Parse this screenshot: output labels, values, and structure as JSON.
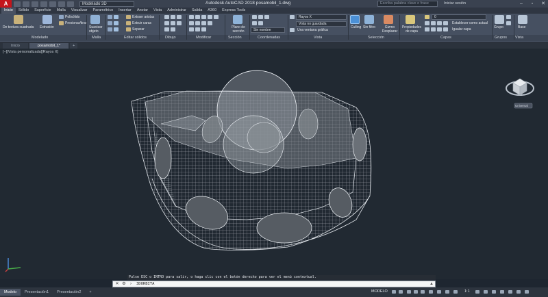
{
  "titlebar": {
    "app_letter": "A",
    "workspace": "Modelado 3D",
    "title": "Autodesk AutoCAD 2018    posamobil_1.dwg",
    "search_placeholder": "Escriba palabra clave o frase",
    "signin": "Iniciar sesión"
  },
  "ribbon_tabs": [
    "Inicio",
    "Sólido",
    "Superficie",
    "Malla",
    "Visualizar",
    "Paramétrico",
    "Insertar",
    "Anotar",
    "Vista",
    "Administrar",
    "Salida",
    "A360",
    "Express Tools"
  ],
  "ribbon": {
    "panels": [
      "Modelado",
      "Malla",
      "Editar sólidos",
      "Dibujo",
      "Modificar",
      "Sección",
      "Coordenadas",
      "Vista",
      "Selección",
      "Capas",
      "Grupos",
      "Vista"
    ],
    "modelado": {
      "box": "De textura cuadrada",
      "extrude": "Extrusión",
      "polysolid": "Polisólido",
      "presspull": "Presionar/tirar"
    },
    "malla": {
      "smooth": "Suavizar objeto"
    },
    "editar": {
      "extrude_edges": "Extraer aristas",
      "extrude_faces": "Extruir caras",
      "separate": "Separar"
    },
    "seccion": {
      "plane": "Plano de sección"
    },
    "coordenadas": {
      "ucs": "Universal",
      "named": "Sin nombre"
    },
    "vista": {
      "visual_style": "Rayos X",
      "saved_view": "Vista no guardada",
      "viewport": "Una ventana gráfica"
    },
    "seleccion": {
      "culling": "Culling",
      "nofilter": "Sin filtro",
      "gizmo": "Gizmo Desplazar"
    },
    "capas": {
      "properties": "Propiedades de capa",
      "layer_value": "0",
      "set_current": "Establecer como actual",
      "match": "Igualar capa"
    },
    "grupos": {
      "group": "Grupo"
    },
    "base": {
      "base": "Base"
    }
  },
  "doc_tabs": [
    "Inicio",
    "posamobil_1*"
  ],
  "viewport": {
    "label": "[−][Vista personalizada][Rayos X]",
    "viewcube_label": "Universal"
  },
  "command": {
    "history": "Pulse ESC o INTRO para salir, o haga clic con el botón derecho para ver el menú contextual.",
    "input": "3DORBITA"
  },
  "status": {
    "tabs": [
      "Modelo",
      "Presentación1",
      "Presentación2"
    ],
    "mode": "MODELO",
    "scale": "1:1"
  }
}
